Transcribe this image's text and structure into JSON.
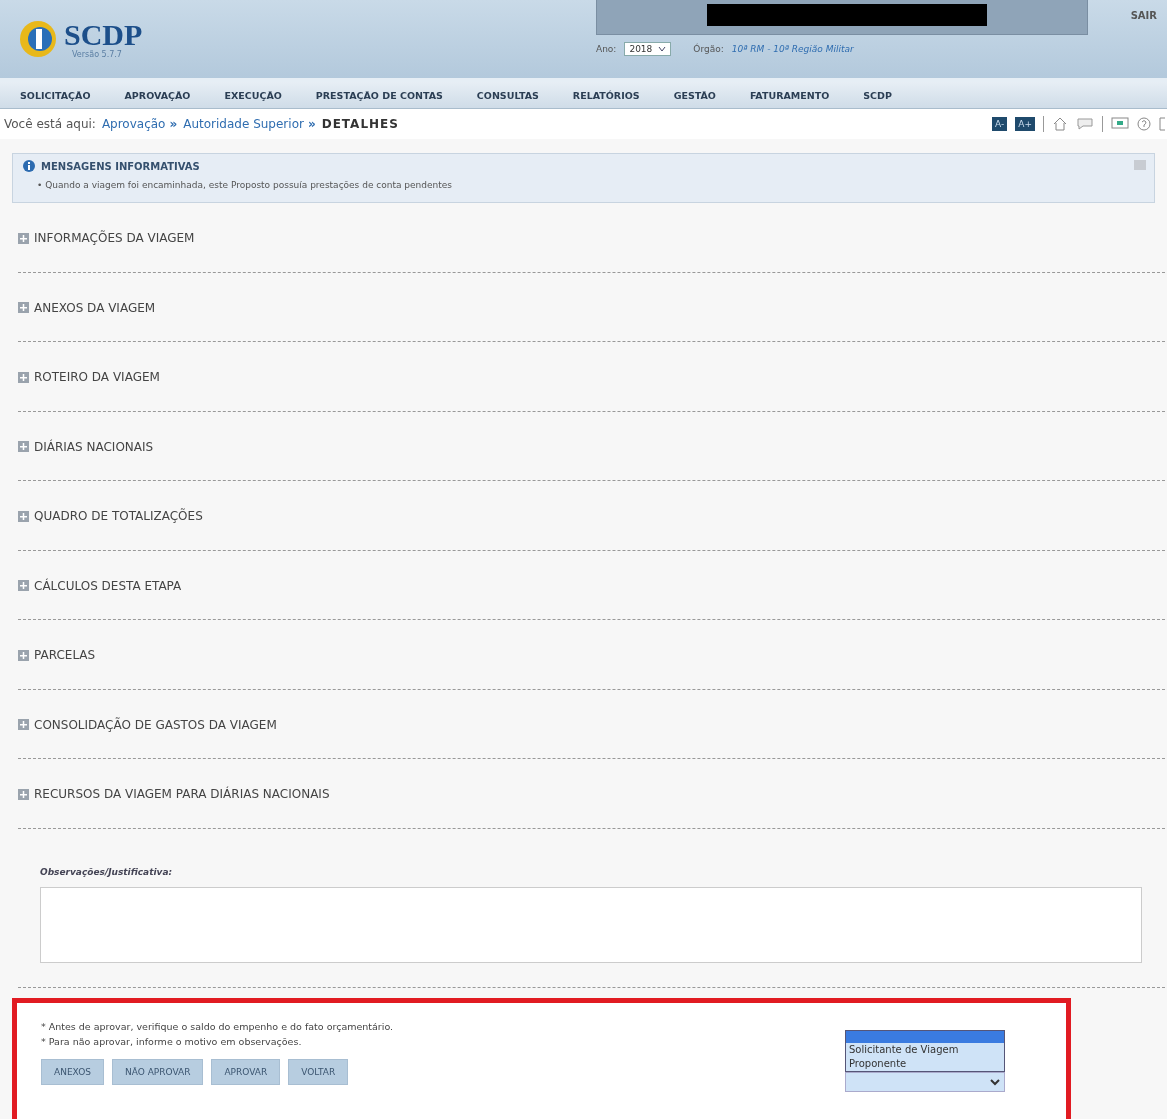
{
  "header": {
    "logo": "SCDP",
    "version": "Versão 5.7.7",
    "year_label": "Ano:",
    "year": "2018",
    "organ_label": "Órgão:",
    "organ": "10ª RM - 10ª Região Militar",
    "logout": "SAIR"
  },
  "menu": [
    {
      "label": "SOLICITAÇÃO"
    },
    {
      "label": "APROVAÇÃO"
    },
    {
      "label": "EXECUÇÃO"
    },
    {
      "label": "PRESTAÇÃO DE CONTAS"
    },
    {
      "label": "CONSULTAS"
    },
    {
      "label": "RELATÓRIOS"
    },
    {
      "label": "GESTÃO"
    },
    {
      "label": "FATURAMENTO"
    },
    {
      "label": "SCDP"
    }
  ],
  "breadcrumb": {
    "prefix": "Você está aqui:",
    "items": [
      "Aprovação",
      "Autoridade Superior",
      "DETALHES"
    ],
    "separator": "»",
    "font_buttons": [
      "A-",
      "A+"
    ]
  },
  "messages": {
    "title": "MENSAGENS INFORMATIVAS",
    "items": [
      "• Quando a viagem foi encaminhada, este Proposto possuía prestações de conta pendentes"
    ]
  },
  "sections": [
    {
      "title": "INFORMAÇÕES DA VIAGEM",
      "expanded": false
    },
    {
      "title": "ANEXOS DA VIAGEM",
      "expanded": false
    },
    {
      "title": "ROTEIRO DA VIAGEM",
      "expanded": false
    },
    {
      "title": "DIÁRIAS NACIONAIS",
      "expanded": false
    },
    {
      "title": "QUADRO DE TOTALIZAÇÕES",
      "expanded": false
    },
    {
      "title": "CÁLCULOS DESTA ETAPA",
      "expanded": false
    },
    {
      "title": "PARCELAS",
      "expanded": false
    },
    {
      "title": "CONSOLIDAÇÃO DE GASTOS DA VIAGEM",
      "expanded": false
    },
    {
      "title": "RECURSOS DA VIAGEM PARA DIÁRIAS NACIONAIS",
      "expanded": false
    }
  ],
  "observations": {
    "label": "Observações/Justificativa:"
  },
  "footer": {
    "notes": [
      "* Antes de aprovar, verifique o saldo do empenho e do fato orçamentário.",
      "* Para não aprovar, informe o motivo em observações."
    ],
    "buttons": [
      "ANEXOS",
      "NÃO APROVAR",
      "APROVAR",
      "VOLTAR"
    ],
    "dropdown": {
      "expanded": true,
      "options": [
        {
          "label": "Solicitante de Viagem",
          "selected": false
        },
        {
          "label": "Proponente",
          "selected": false
        }
      ]
    }
  }
}
